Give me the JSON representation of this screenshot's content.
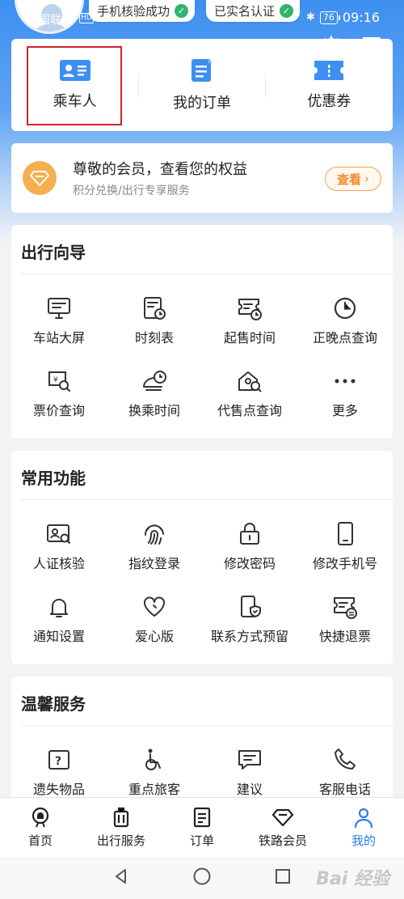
{
  "status_bar": {
    "carrier": "中国联通",
    "hd": "HD",
    "chip_phone": "手机核验成功",
    "chip_realname": "已实名认证",
    "battery": "76",
    "time": "09:16"
  },
  "top_icons": [
    "gear-icon",
    "message-icon"
  ],
  "quick_links": [
    {
      "label": "乘车人",
      "icon": "passenger-card-icon"
    },
    {
      "label": "我的订单",
      "icon": "order-doc-icon"
    },
    {
      "label": "优惠券",
      "icon": "coupon-ticket-icon"
    }
  ],
  "member": {
    "title": "尊敬的会员，查看您的权益",
    "subtitle": "积分兑换/出行专享服务",
    "button": "查看"
  },
  "guide": {
    "title": "出行向导",
    "items": [
      {
        "label": "车站大屏",
        "icon": "station-screen-icon"
      },
      {
        "label": "时刻表",
        "icon": "timetable-icon"
      },
      {
        "label": "起售时间",
        "icon": "sale-time-icon"
      },
      {
        "label": "正晚点查询",
        "icon": "clock-icon"
      },
      {
        "label": "票价查询",
        "icon": "fare-search-icon"
      },
      {
        "label": "换乘时间",
        "icon": "transfer-time-icon"
      },
      {
        "label": "代售点查询",
        "icon": "agency-search-icon"
      },
      {
        "label": "更多",
        "icon": "more-dots-icon"
      }
    ]
  },
  "common": {
    "title": "常用功能",
    "items": [
      {
        "label": "人证核验",
        "icon": "id-verify-icon"
      },
      {
        "label": "指纹登录",
        "icon": "fingerprint-icon"
      },
      {
        "label": "修改密码",
        "icon": "lock-icon"
      },
      {
        "label": "修改手机号",
        "icon": "phone-icon"
      },
      {
        "label": "通知设置",
        "icon": "bell-icon"
      },
      {
        "label": "爱心版",
        "icon": "heart-icon"
      },
      {
        "label": "联系方式预留",
        "icon": "contact-shield-icon"
      },
      {
        "label": "快捷退票",
        "icon": "quick-refund-icon"
      }
    ]
  },
  "warm": {
    "title": "温馨服务",
    "items": [
      {
        "label": "遗失物品",
        "icon": "lost-item-icon"
      },
      {
        "label": "重点旅客",
        "icon": "wheelchair-icon"
      },
      {
        "label": "建议",
        "icon": "suggestion-icon"
      },
      {
        "label": "客服电话",
        "icon": "phone-call-icon"
      }
    ]
  },
  "tabs": [
    {
      "label": "首页",
      "icon": "home-train-icon",
      "active": false
    },
    {
      "label": "出行服务",
      "icon": "luggage-icon",
      "active": false
    },
    {
      "label": "订单",
      "icon": "order-icon",
      "active": false
    },
    {
      "label": "铁路会员",
      "icon": "diamond-icon",
      "active": false
    },
    {
      "label": "我的",
      "icon": "user-icon",
      "active": true
    }
  ],
  "colors": {
    "accent": "#2b7de9",
    "highlight": "#d5202a",
    "member_orange": "#f4b04e"
  },
  "watermark": "Bai 经验"
}
